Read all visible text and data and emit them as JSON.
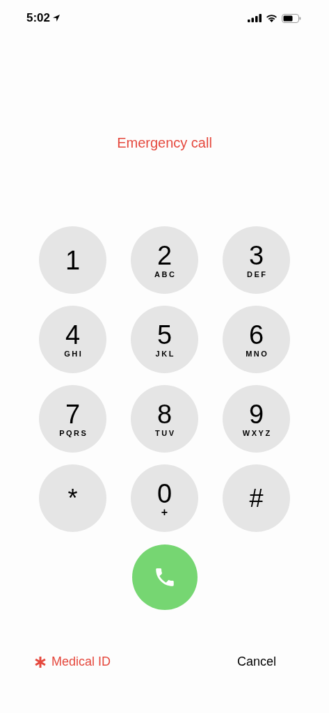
{
  "status_bar": {
    "time": "5:02"
  },
  "title": "Emergency call",
  "keys": [
    {
      "digit": "1"
    },
    {
      "digit": "2",
      "letters": "ABC"
    },
    {
      "digit": "3",
      "letters": "DEF"
    },
    {
      "digit": "4",
      "letters": "GHI"
    },
    {
      "digit": "5",
      "letters": "JKL"
    },
    {
      "digit": "6",
      "letters": "MNO"
    },
    {
      "digit": "7",
      "letters": "PQRS"
    },
    {
      "digit": "8",
      "letters": "TUV"
    },
    {
      "digit": "9",
      "letters": "WXYZ"
    },
    {
      "digit": "*"
    },
    {
      "digit": "0",
      "letters": "+"
    },
    {
      "digit": "#"
    }
  ],
  "footer": {
    "medical_id": "Medical ID",
    "cancel": "Cancel"
  }
}
